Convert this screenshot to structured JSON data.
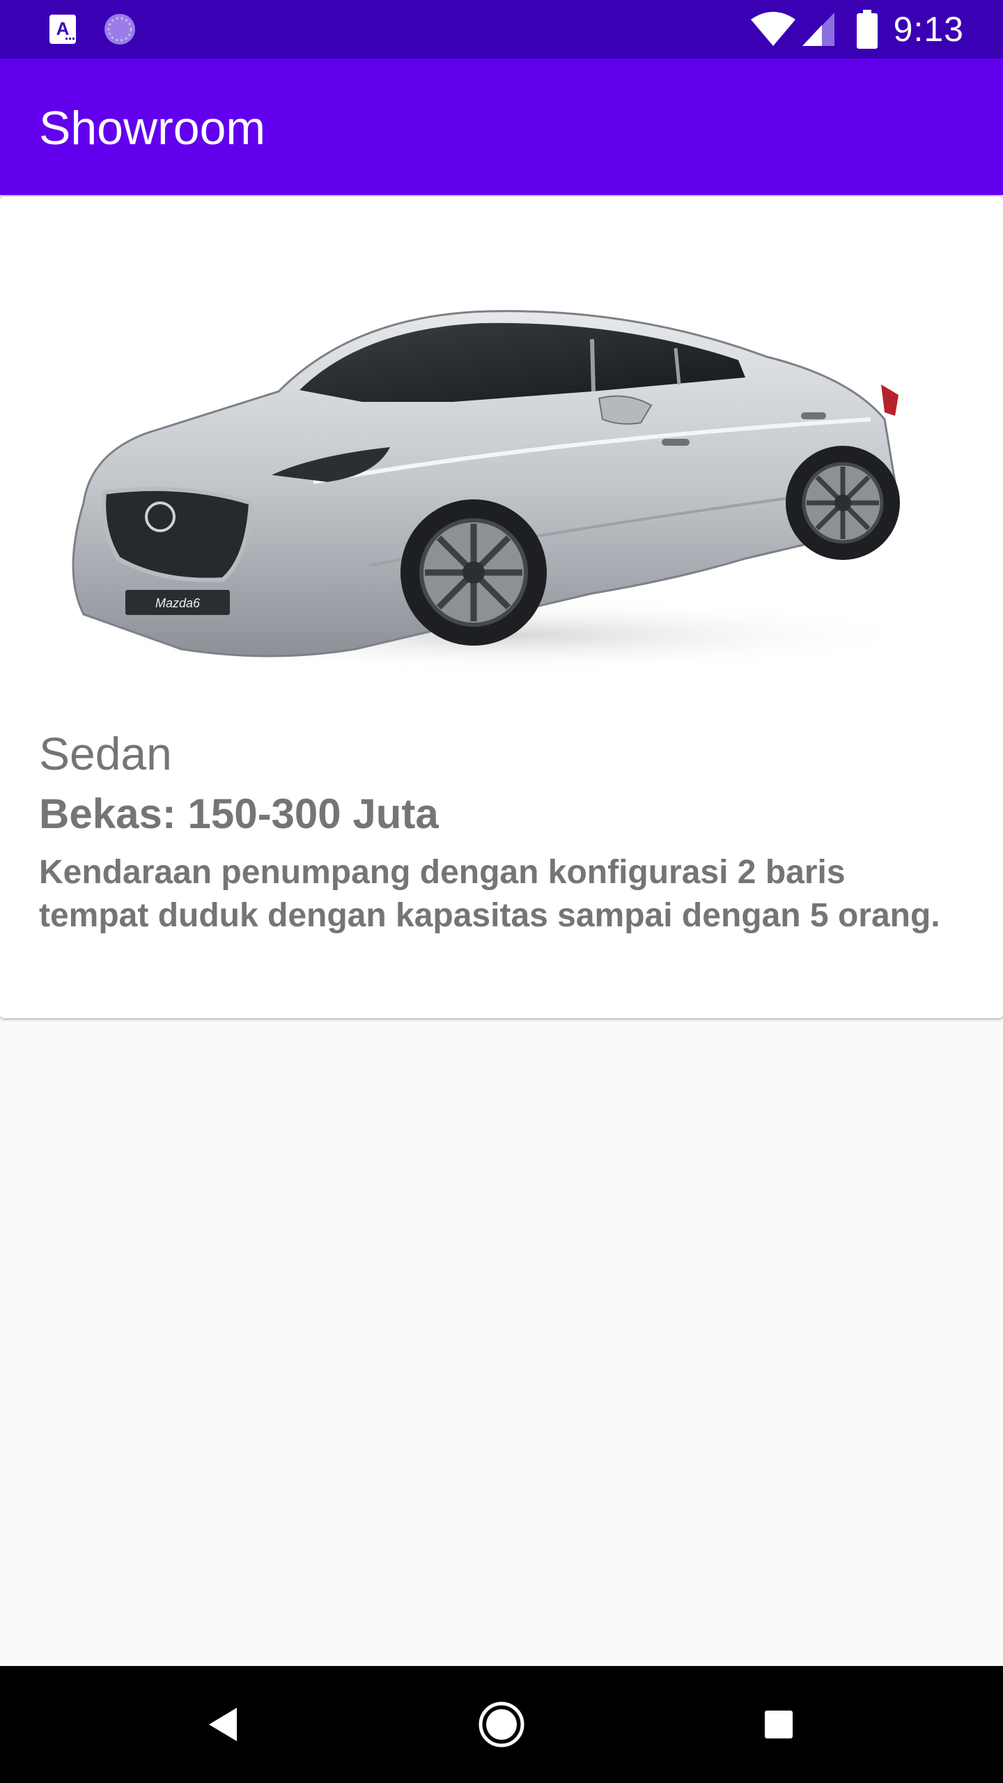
{
  "status_bar": {
    "time": "9:13",
    "icons": [
      "accessibility-a-icon",
      "sync-spinner-icon",
      "wifi-icon",
      "signal-icon",
      "battery-icon"
    ]
  },
  "app_bar": {
    "title": "Showroom"
  },
  "vehicle": {
    "name": "Sedan",
    "price": "Bekas: 150-300 Juta",
    "description": "Kendaraan penumpang dengan konfigurasi 2 baris tempat duduk dengan kapasitas sampai dengan 5 orang.",
    "badge_text": "Mazda6",
    "image_icon": "car-photo"
  },
  "nav_bar": {
    "buttons": [
      "back-icon",
      "home-icon",
      "recents-icon"
    ]
  },
  "colors": {
    "status_bar": "#3a00b4",
    "app_bar": "#6200ee",
    "text": "#757575"
  }
}
